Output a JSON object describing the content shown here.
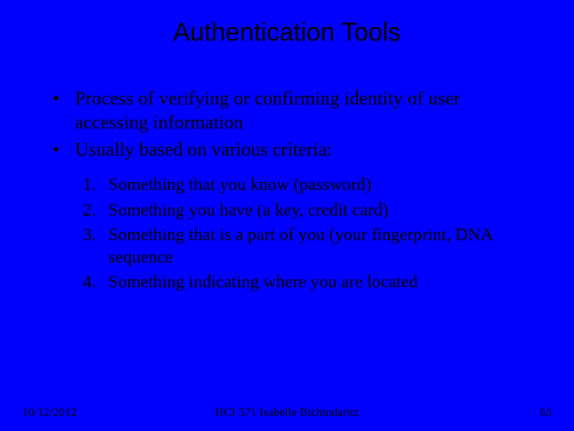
{
  "title": "Authentication Tools",
  "bullets": {
    "b1": "Process of verifying or confirming identity of user accessing information",
    "b2": "Usually based on various criteria:"
  },
  "criteria": {
    "c1": "Something that you know (password)",
    "c2": "Something you have (a key, credit card)",
    "c3": "Something that is a part of you (your fingerprint, DNA sequence",
    "c4": "Something indicating where you are located"
  },
  "footer": {
    "date": "10/12/2012",
    "center": "HCI 571   Isabelle Bichindaritz",
    "page": "63"
  }
}
